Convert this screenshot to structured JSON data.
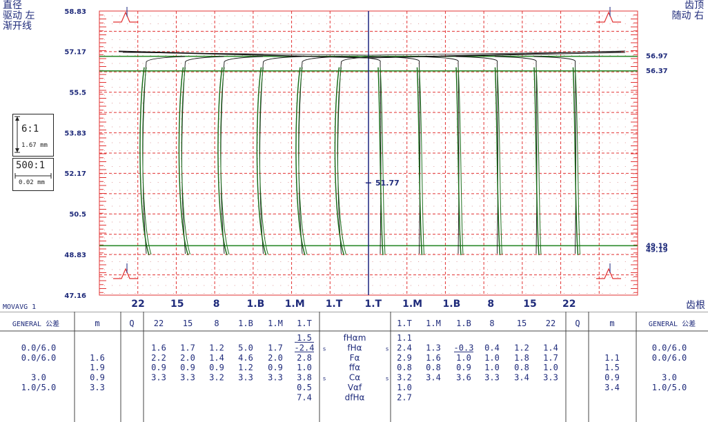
{
  "header": {
    "left_lines": [
      "直径",
      "驱动 左",
      "渐开线"
    ],
    "right_lines": [
      "齿顶",
      "随动 右"
    ],
    "bottom_right": "齿根",
    "movavg": "MOVAVG 1"
  },
  "scale": {
    "vertical_ratio": "6:1",
    "vertical_length": "1.67 mm",
    "horizontal_ratio": "500:1",
    "horizontal_length": "0.02 mm"
  },
  "chart_data": {
    "type": "line",
    "y_ticks": [
      "58.83",
      "57.17",
      "55.5",
      "53.83",
      "52.17",
      "50.5",
      "48.83",
      "47.16"
    ],
    "ylim": [
      47.16,
      58.83
    ],
    "reference_lines": [
      {
        "value": 56.97,
        "label": "56.97"
      },
      {
        "value": 56.37,
        "label": "56.37"
      },
      {
        "value": 49.19,
        "label": "49.19"
      },
      {
        "value": 49.19,
        "label": "49.19"
      }
    ],
    "center_label": "51.77",
    "center_value": 51.77,
    "tooth_labels": [
      "22",
      "15",
      "8",
      "1.B",
      "1.M",
      "1.T",
      "1.T",
      "1.M",
      "1.B",
      "8",
      "15",
      "22"
    ],
    "colors": {
      "profile": "#1c6e1c",
      "reference": "#2b8a2b",
      "grid": "#e23030",
      "axis": "#1a237e",
      "trace": "#111111"
    }
  },
  "table": {
    "left_header": {
      "general": "GENERAL 公差",
      "m": "m",
      "q": "Q",
      "teeth": [
        "22",
        "15",
        "8",
        "1.B",
        "1.M",
        "1.T"
      ]
    },
    "right_header": {
      "teeth": [
        "1.T",
        "1.M",
        "1.B",
        "8",
        "15",
        "22"
      ],
      "q": "Q",
      "m": "m",
      "general": "GENERAL 公差"
    },
    "params": [
      "fHαm",
      "fHα",
      "Fα",
      "ffα",
      "Cα",
      "Vαf",
      "dfHα"
    ],
    "s_marks": [
      "",
      "s",
      "",
      "",
      "s",
      "",
      ""
    ],
    "left_general": [
      "",
      "0.0/6.0",
      "0.0/6.0",
      "",
      "3.0",
      "1.0/5.0",
      ""
    ],
    "left_m": [
      "",
      "",
      "1.6",
      "1.9",
      "0.9",
      "3.3",
      ""
    ],
    "left_teeth": [
      [
        "",
        "",
        "",
        "",
        "",
        "1.5"
      ],
      [
        "1.6",
        "1.7",
        "1.2",
        "5.0",
        "1.7",
        "-2.4"
      ],
      [
        "2.2",
        "2.0",
        "1.4",
        "4.6",
        "2.0",
        "2.8"
      ],
      [
        "0.9",
        "0.9",
        "0.9",
        "1.2",
        "0.9",
        "1.0"
      ],
      [
        "3.3",
        "3.3",
        "3.2",
        "3.3",
        "3.3",
        "3.8"
      ],
      [
        "",
        "",
        "",
        "",
        "",
        "0.5"
      ],
      [
        "",
        "",
        "",
        "",
        "",
        "7.4"
      ]
    ],
    "right_teeth": [
      [
        "1.1",
        "",
        "",
        "",
        "",
        ""
      ],
      [
        "2.4",
        "1.3",
        "-0.3",
        "0.4",
        "1.2",
        "1.4"
      ],
      [
        "2.9",
        "1.6",
        "1.0",
        "1.0",
        "1.8",
        "1.7"
      ],
      [
        "0.8",
        "0.8",
        "0.9",
        "1.0",
        "0.8",
        "1.0"
      ],
      [
        "3.2",
        "3.4",
        "3.6",
        "3.3",
        "3.4",
        "3.3"
      ],
      [
        "1.0",
        "",
        "",
        "",
        "",
        ""
      ],
      [
        "2.7",
        "",
        "",
        "",
        "",
        ""
      ]
    ],
    "right_m": [
      "",
      "",
      "1.1",
      "1.5",
      "0.9",
      "3.4",
      ""
    ],
    "right_general": [
      "",
      "0.0/6.0",
      "0.0/6.0",
      "",
      "3.0",
      "1.0/5.0",
      ""
    ]
  }
}
